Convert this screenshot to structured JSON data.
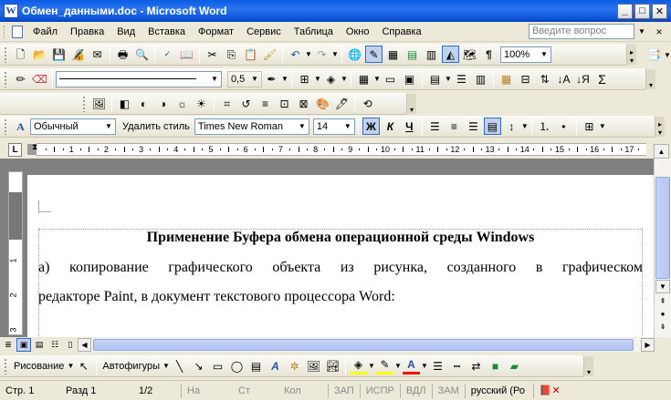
{
  "window": {
    "title": "Обмен_данными.doc - Microsoft Word",
    "app_icon_letter": "W"
  },
  "menu": {
    "items": [
      "Файл",
      "Правка",
      "Вид",
      "Вставка",
      "Формат",
      "Сервис",
      "Таблица",
      "Окно",
      "Справка"
    ],
    "help_placeholder": "Введите вопрос",
    "close_doc": "×"
  },
  "toolbar_standard": {
    "zoom": "100%"
  },
  "toolbar_tables": {
    "line_weight": "0,5"
  },
  "toolbar_formatting": {
    "style": "Обычный",
    "clear_style_label": "Удалить стиль",
    "font": "Times New Roman",
    "size": "14",
    "bold": "Ж",
    "italic": "К",
    "underline": "Ч"
  },
  "ruler": {
    "numbers": [
      "1",
      "2",
      "3",
      "4",
      "5",
      "6",
      "7",
      "8",
      "9",
      "10",
      "11",
      "12",
      "13",
      "14",
      "15",
      "16",
      "17"
    ]
  },
  "vruler": {
    "numbers": [
      "1",
      "2",
      "3"
    ]
  },
  "document": {
    "heading": "Применение Буфера обмена операционной среды Windows",
    "line1_words": [
      "а)",
      "копирование",
      "графического",
      "объекта",
      "из",
      "рисунка,",
      "созданного",
      "в",
      "графическом"
    ],
    "line2": "редакторе Paint, в документ текстового процессора Word:"
  },
  "drawing_toolbar": {
    "draw_label": "Рисование",
    "autoshapes_label": "Автофигуры"
  },
  "statusbar": {
    "page": "Стр. 1",
    "section": "Разд 1",
    "pages": "1/2",
    "at": "На",
    "line": "Ст",
    "column": "Кол",
    "rec": "ЗАП",
    "trk": "ИСПР",
    "ext": "ВДЛ",
    "ovr": "ЗАМ",
    "language": "русский (Ро"
  },
  "colors": {
    "titlebar": "#0a5de4",
    "highlight": "#ffff00",
    "font_color": "#ff0000",
    "selection": "#c1d2ee"
  }
}
